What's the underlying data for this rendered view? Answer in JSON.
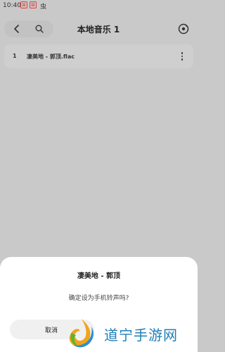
{
  "status_bar": {
    "time": "10:40",
    "notification_badges": [
      "⊠",
      "⊠"
    ],
    "bug_glyph": "虫"
  },
  "header": {
    "title": "本地音乐 1",
    "icons": {
      "back": "back-chevron-icon",
      "search": "search-icon",
      "disc": "music-disc-icon"
    }
  },
  "song_list": [
    {
      "index": "1",
      "name": "凄美地 - 郭顶.flac"
    }
  ],
  "dialog": {
    "title": "凄美地 - 郭顶",
    "message": "确定设为手机铃声吗?",
    "cancel_label": "取消"
  },
  "watermark": {
    "text": "道宁手游网"
  },
  "colors": {
    "background_overlay": "#c9c9c9",
    "dialog_background": "#ffffff",
    "watermark_text": "#1f7fb8",
    "notif_red": "#e0403a"
  }
}
